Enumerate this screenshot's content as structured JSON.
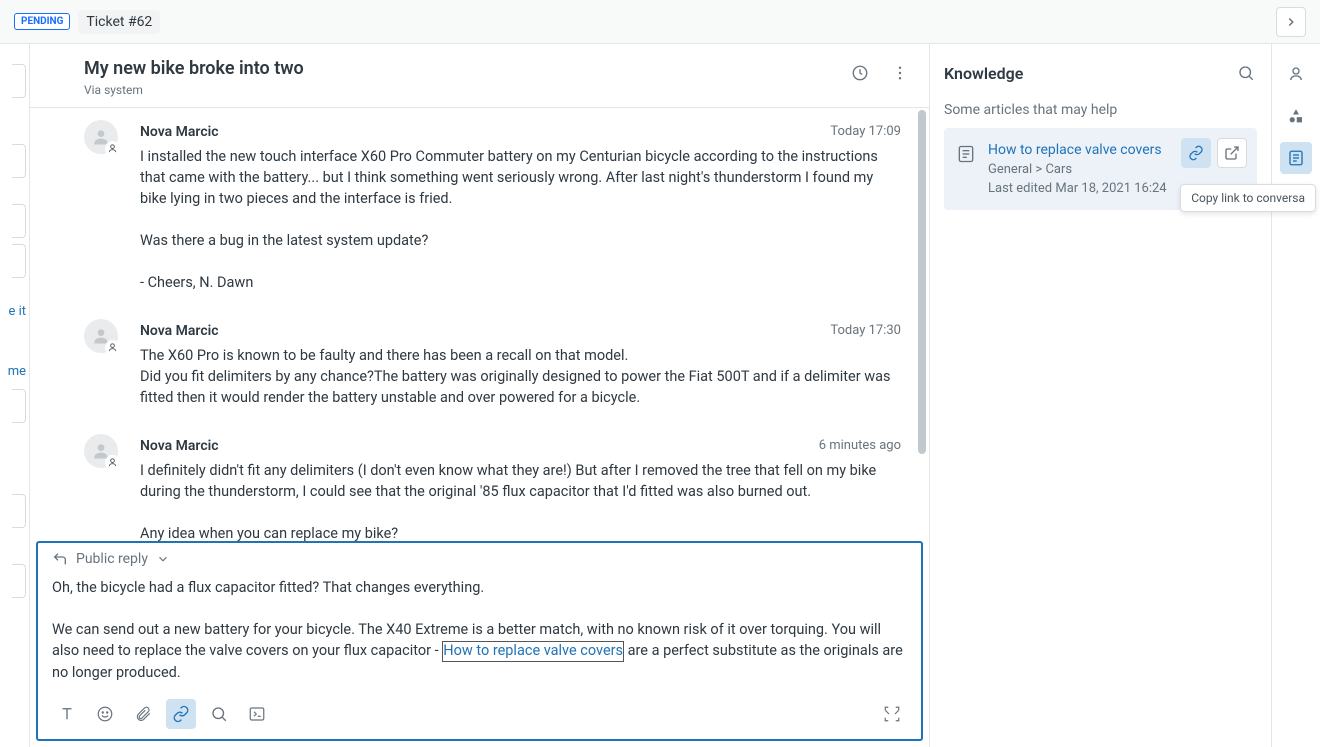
{
  "header": {
    "status": "PENDING",
    "ticket_label": "Ticket #62"
  },
  "ticket": {
    "subject": "My new bike broke into two",
    "via": "Via system"
  },
  "messages": [
    {
      "author": "Nova Marcic",
      "timestamp": "Today 17:09",
      "body": "I installed the new touch interface X60 Pro Commuter battery on my Centurian bicycle according to the instructions that came with the battery... but I think something went seriously wrong. After last night's thunderstorm I found my bike lying in two pieces and the interface is fried.\n\nWas there a bug in the latest system update?\n\n- Cheers, N. Dawn"
    },
    {
      "author": "Nova Marcic",
      "timestamp": "Today 17:30",
      "body": "The X60 Pro is known to be faulty and there has been a recall on that model.\nDid you fit delimiters by any chance?The battery was originally designed to power the Fiat 500T and if a delimiter was fitted then it would render the battery unstable and over powered for a bicycle."
    },
    {
      "author": "Nova Marcic",
      "timestamp": "6 minutes ago",
      "body": "I definitely didn't fit any delimiters (I don't even know what they are!) But after I removed the tree that fell on my bike during the thunderstorm, I could see that the original '85 flux capacitor that I'd fitted was also burned out.\n\nAny idea when you can replace my bike?"
    }
  ],
  "composer": {
    "mode_label": "Public reply",
    "text_before_link": "Oh, the bicycle had a flux capacitor fitted? That changes everything.\n\nWe can send out a new battery for your bicycle. The X40 Extreme is a better match, with no known risk of it over torquing. You will also need to replace the valve covers on your flux capacitor - ",
    "link_text": "How to replace valve covers",
    "text_after_link": " are a perfect substitute as the originals are no longer produced."
  },
  "knowledge": {
    "title": "Knowledge",
    "hint": "Some articles that may help",
    "article": {
      "title": "How to replace valve covers",
      "path": "General > Cars",
      "meta": "Last edited Mar 18, 2021 16:24"
    }
  },
  "tooltip": "Copy link to conversa",
  "left_stub": {
    "item1": "e it",
    "item2": "me"
  }
}
